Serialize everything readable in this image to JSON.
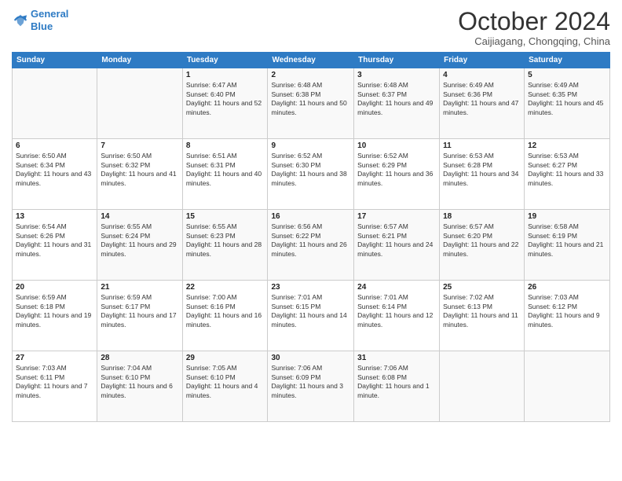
{
  "header": {
    "logo_line1": "General",
    "logo_line2": "Blue",
    "month_title": "October 2024",
    "location": "Caijiagang, Chongqing, China"
  },
  "days_of_week": [
    "Sunday",
    "Monday",
    "Tuesday",
    "Wednesday",
    "Thursday",
    "Friday",
    "Saturday"
  ],
  "weeks": [
    [
      {
        "day": "",
        "info": ""
      },
      {
        "day": "",
        "info": ""
      },
      {
        "day": "1",
        "info": "Sunrise: 6:47 AM\nSunset: 6:40 PM\nDaylight: 11 hours and 52 minutes."
      },
      {
        "day": "2",
        "info": "Sunrise: 6:48 AM\nSunset: 6:38 PM\nDaylight: 11 hours and 50 minutes."
      },
      {
        "day": "3",
        "info": "Sunrise: 6:48 AM\nSunset: 6:37 PM\nDaylight: 11 hours and 49 minutes."
      },
      {
        "day": "4",
        "info": "Sunrise: 6:49 AM\nSunset: 6:36 PM\nDaylight: 11 hours and 47 minutes."
      },
      {
        "day": "5",
        "info": "Sunrise: 6:49 AM\nSunset: 6:35 PM\nDaylight: 11 hours and 45 minutes."
      }
    ],
    [
      {
        "day": "6",
        "info": "Sunrise: 6:50 AM\nSunset: 6:34 PM\nDaylight: 11 hours and 43 minutes."
      },
      {
        "day": "7",
        "info": "Sunrise: 6:50 AM\nSunset: 6:32 PM\nDaylight: 11 hours and 41 minutes."
      },
      {
        "day": "8",
        "info": "Sunrise: 6:51 AM\nSunset: 6:31 PM\nDaylight: 11 hours and 40 minutes."
      },
      {
        "day": "9",
        "info": "Sunrise: 6:52 AM\nSunset: 6:30 PM\nDaylight: 11 hours and 38 minutes."
      },
      {
        "day": "10",
        "info": "Sunrise: 6:52 AM\nSunset: 6:29 PM\nDaylight: 11 hours and 36 minutes."
      },
      {
        "day": "11",
        "info": "Sunrise: 6:53 AM\nSunset: 6:28 PM\nDaylight: 11 hours and 34 minutes."
      },
      {
        "day": "12",
        "info": "Sunrise: 6:53 AM\nSunset: 6:27 PM\nDaylight: 11 hours and 33 minutes."
      }
    ],
    [
      {
        "day": "13",
        "info": "Sunrise: 6:54 AM\nSunset: 6:26 PM\nDaylight: 11 hours and 31 minutes."
      },
      {
        "day": "14",
        "info": "Sunrise: 6:55 AM\nSunset: 6:24 PM\nDaylight: 11 hours and 29 minutes."
      },
      {
        "day": "15",
        "info": "Sunrise: 6:55 AM\nSunset: 6:23 PM\nDaylight: 11 hours and 28 minutes."
      },
      {
        "day": "16",
        "info": "Sunrise: 6:56 AM\nSunset: 6:22 PM\nDaylight: 11 hours and 26 minutes."
      },
      {
        "day": "17",
        "info": "Sunrise: 6:57 AM\nSunset: 6:21 PM\nDaylight: 11 hours and 24 minutes."
      },
      {
        "day": "18",
        "info": "Sunrise: 6:57 AM\nSunset: 6:20 PM\nDaylight: 11 hours and 22 minutes."
      },
      {
        "day": "19",
        "info": "Sunrise: 6:58 AM\nSunset: 6:19 PM\nDaylight: 11 hours and 21 minutes."
      }
    ],
    [
      {
        "day": "20",
        "info": "Sunrise: 6:59 AM\nSunset: 6:18 PM\nDaylight: 11 hours and 19 minutes."
      },
      {
        "day": "21",
        "info": "Sunrise: 6:59 AM\nSunset: 6:17 PM\nDaylight: 11 hours and 17 minutes."
      },
      {
        "day": "22",
        "info": "Sunrise: 7:00 AM\nSunset: 6:16 PM\nDaylight: 11 hours and 16 minutes."
      },
      {
        "day": "23",
        "info": "Sunrise: 7:01 AM\nSunset: 6:15 PM\nDaylight: 11 hours and 14 minutes."
      },
      {
        "day": "24",
        "info": "Sunrise: 7:01 AM\nSunset: 6:14 PM\nDaylight: 11 hours and 12 minutes."
      },
      {
        "day": "25",
        "info": "Sunrise: 7:02 AM\nSunset: 6:13 PM\nDaylight: 11 hours and 11 minutes."
      },
      {
        "day": "26",
        "info": "Sunrise: 7:03 AM\nSunset: 6:12 PM\nDaylight: 11 hours and 9 minutes."
      }
    ],
    [
      {
        "day": "27",
        "info": "Sunrise: 7:03 AM\nSunset: 6:11 PM\nDaylight: 11 hours and 7 minutes."
      },
      {
        "day": "28",
        "info": "Sunrise: 7:04 AM\nSunset: 6:10 PM\nDaylight: 11 hours and 6 minutes."
      },
      {
        "day": "29",
        "info": "Sunrise: 7:05 AM\nSunset: 6:10 PM\nDaylight: 11 hours and 4 minutes."
      },
      {
        "day": "30",
        "info": "Sunrise: 7:06 AM\nSunset: 6:09 PM\nDaylight: 11 hours and 3 minutes."
      },
      {
        "day": "31",
        "info": "Sunrise: 7:06 AM\nSunset: 6:08 PM\nDaylight: 11 hours and 1 minute."
      },
      {
        "day": "",
        "info": ""
      },
      {
        "day": "",
        "info": ""
      }
    ]
  ]
}
